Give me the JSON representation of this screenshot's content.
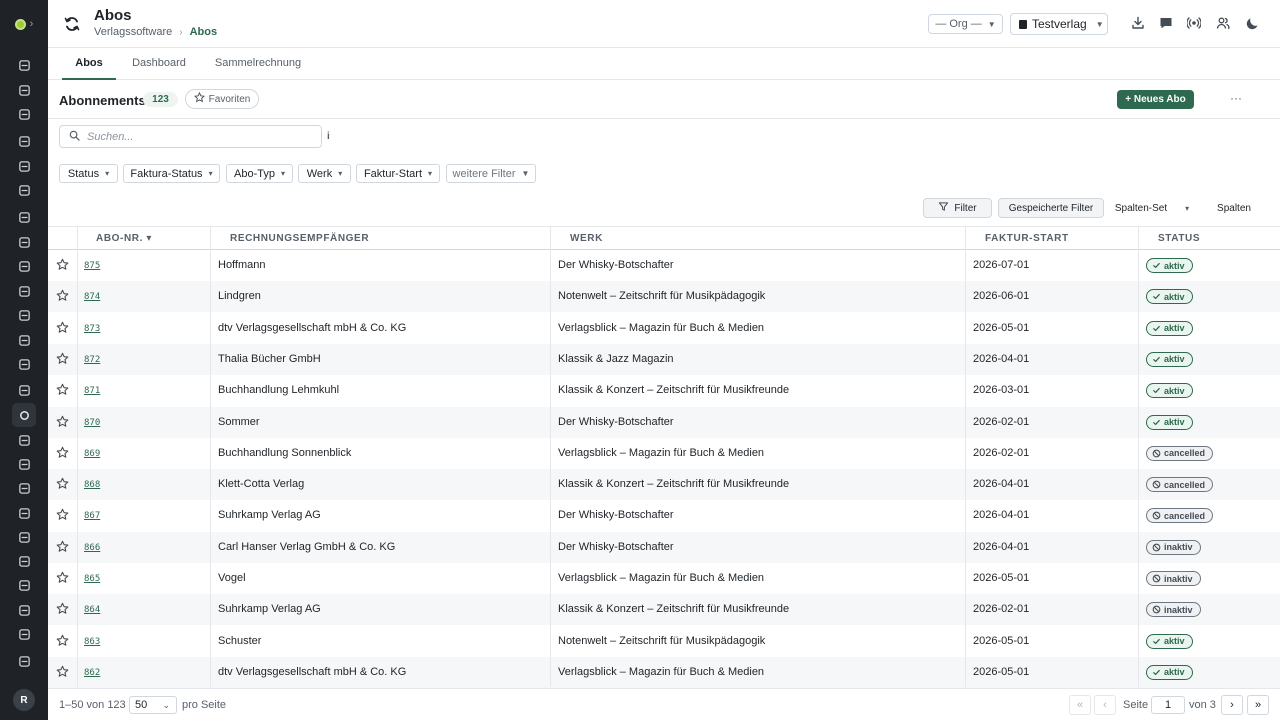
{
  "header": {
    "title": "Abos",
    "breadcrumb": [
      "Verlagssoftware",
      "Abos"
    ],
    "org_select": "— Org —",
    "verlag_select": "Testverlag"
  },
  "tabs": [
    {
      "label": "Abos",
      "active": true
    },
    {
      "label": "Dashboard",
      "active": false
    },
    {
      "label": "Sammelrechnung",
      "active": false
    }
  ],
  "toolbar": {
    "title": "Abonnements",
    "count": "123",
    "favorites_label": "Favoriten",
    "new_label": "+ Neues Abo",
    "more_label": "···",
    "search_placeholder": "Suchen...",
    "info_label": "i"
  },
  "filters": {
    "chips": [
      "Status",
      "Faktura-Status",
      "Abo-Typ",
      "Werk",
      "Faktur-Start",
      "weitere Filter"
    ],
    "filter_label": "Filter",
    "saved_label": "Gespeicherte Filter",
    "column_set_label": "Spalten-Set",
    "columns_label": "Spalten"
  },
  "table": {
    "headers": [
      "Abo-Nr. ▾",
      "Rechnungsempfänger",
      "Werk",
      "Faktur-Start",
      "Status"
    ],
    "rows": [
      {
        "nr": "875",
        "empf": "Hoffmann",
        "werk": "Der Whisky-Botschafter",
        "start": "2026-07-01",
        "status": "aktiv"
      },
      {
        "nr": "874",
        "empf": "Lindgren",
        "werk": "Notenwelt – Zeitschrift für Musikpädagogik",
        "start": "2026-06-01",
        "status": "aktiv"
      },
      {
        "nr": "873",
        "empf": "dtv Verlagsgesellschaft mbH & Co. KG",
        "werk": "Verlagsblick – Magazin für Buch & Medien",
        "start": "2026-05-01",
        "status": "aktiv"
      },
      {
        "nr": "872",
        "empf": "Thalia Bücher GmbH",
        "werk": "Klassik & Jazz Magazin",
        "start": "2026-04-01",
        "status": "aktiv"
      },
      {
        "nr": "871",
        "empf": "Buchhandlung Lehmkuhl",
        "werk": "Klassik & Konzert – Zeitschrift für Musikfreunde",
        "start": "2026-03-01",
        "status": "aktiv"
      },
      {
        "nr": "870",
        "empf": "Sommer",
        "werk": "Der Whisky-Botschafter",
        "start": "2026-02-01",
        "status": "aktiv"
      },
      {
        "nr": "869",
        "empf": "Buchhandlung Sonnenblick",
        "werk": "Verlagsblick – Magazin für Buch & Medien",
        "start": "2026-02-01",
        "status": "cancelled"
      },
      {
        "nr": "868",
        "empf": "Klett-Cotta Verlag",
        "werk": "Klassik & Konzert – Zeitschrift für Musikfreunde",
        "start": "2026-04-01",
        "status": "cancelled"
      },
      {
        "nr": "867",
        "empf": "Suhrkamp Verlag AG",
        "werk": "Der Whisky-Botschafter",
        "start": "2026-04-01",
        "status": "cancelled"
      },
      {
        "nr": "866",
        "empf": "Carl Hanser Verlag GmbH & Co. KG",
        "werk": "Der Whisky-Botschafter",
        "start": "2026-04-01",
        "status": "inaktiv"
      },
      {
        "nr": "865",
        "empf": "Vogel",
        "werk": "Verlagsblick – Magazin für Buch & Medien",
        "start": "2026-05-01",
        "status": "inaktiv"
      },
      {
        "nr": "864",
        "empf": "Suhrkamp Verlag AG",
        "werk": "Klassik & Konzert – Zeitschrift für Musikfreunde",
        "start": "2026-02-01",
        "status": "inaktiv"
      },
      {
        "nr": "863",
        "empf": "Schuster",
        "werk": "Notenwelt – Zeitschrift für Musikpädagogik",
        "start": "2026-05-01",
        "status": "aktiv"
      },
      {
        "nr": "862",
        "empf": "dtv Verlagsgesellschaft mbH & Co. KG",
        "werk": "Verlagsblick – Magazin für Buch & Medien",
        "start": "2026-05-01",
        "status": "aktiv"
      }
    ]
  },
  "footer": {
    "range": "1–50 von 123",
    "page_size": "50",
    "per_page": "pro Seite",
    "page_label": "Seite",
    "page": "1",
    "of_pages": "von 3",
    "first": "«",
    "prev": "‹",
    "next": "›",
    "last": "»"
  },
  "user": {
    "initial": "R"
  },
  "colors": {
    "accent": "#2e6a4f",
    "sidebar": "#1f2328",
    "logo": "#9acd32"
  }
}
